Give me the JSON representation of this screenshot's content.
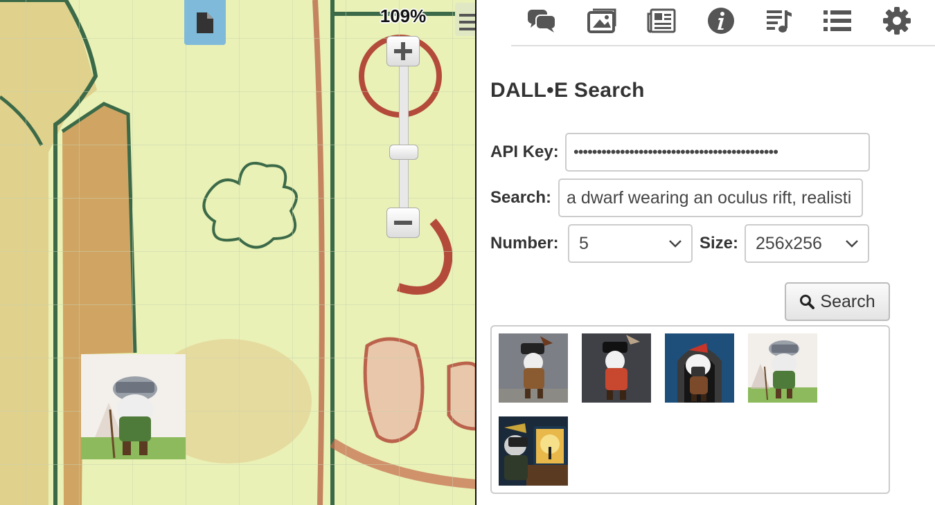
{
  "map": {
    "zoom_label": "109%",
    "token_name": "dwarf-token"
  },
  "toolbar": {
    "icons": [
      "chat-icon",
      "image-gallery-icon",
      "newspaper-icon",
      "info-icon",
      "music-playlist-icon",
      "list-icon",
      "gear-icon"
    ]
  },
  "panel": {
    "title": "DALL•E Search",
    "api_key_label": "API Key:",
    "api_key_value": "••••••••••••••••••••••••••••••••••••••••••••",
    "search_label": "Search:",
    "search_value": "a dwarf wearing an oculus rift, realisti",
    "number_label": "Number:",
    "number_value": "5",
    "size_label": "Size:",
    "size_value": "256x256",
    "search_button": "Search"
  },
  "results": {
    "count": 5,
    "backgrounds": [
      "#7d7f86",
      "#3f4147",
      "#1e4f7a",
      "#c8d0c4",
      "#1b2a3a"
    ]
  }
}
